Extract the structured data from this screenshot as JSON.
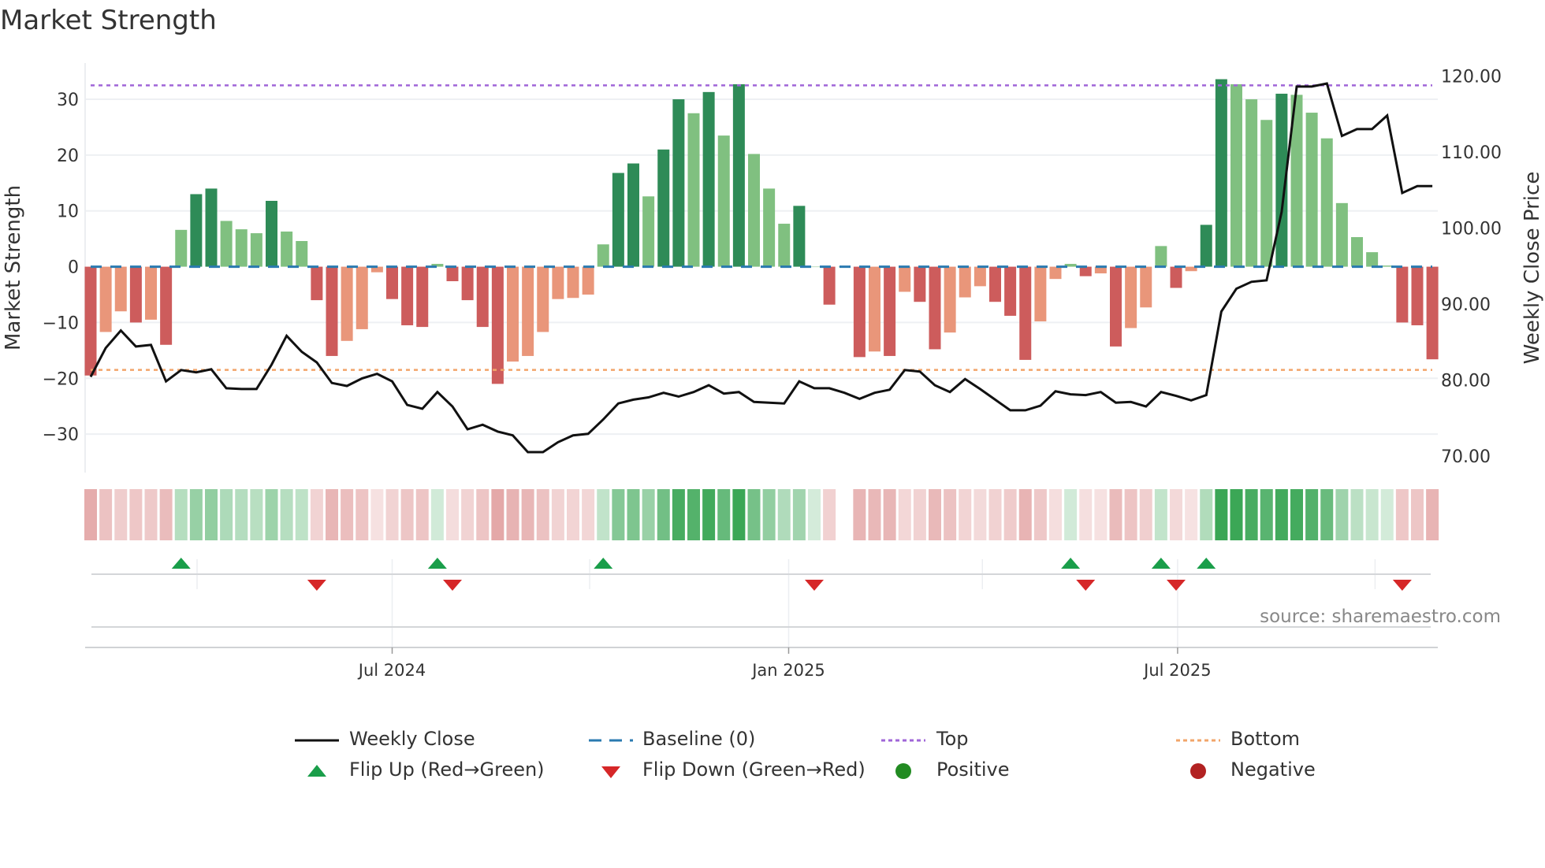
{
  "title": "Market Strength",
  "source": "source: sharemaestro.com",
  "legend": [
    {
      "label": "Weekly Close",
      "icon": "solid-line",
      "color": "#111111"
    },
    {
      "label": "Baseline (0)",
      "icon": "dashed-line",
      "color": "#2a7ab0"
    },
    {
      "label": "Top",
      "icon": "dotted-line",
      "color": "#a066d8"
    },
    {
      "label": "Bottom",
      "icon": "dotted-line",
      "color": "#f2a56a"
    },
    {
      "label": "Flip Up (Red→Green)",
      "icon": "triangle-up",
      "color": "#1a9e4a"
    },
    {
      "label": "Flip Down (Green→Red)",
      "icon": "triangle-down",
      "color": "#d62728"
    },
    {
      "label": "Positive",
      "icon": "circle",
      "color": "#228b22"
    },
    {
      "label": "Negative",
      "icon": "circle",
      "color": "#b22222"
    }
  ],
  "chart_data": {
    "type": "bar",
    "title": "Market Strength",
    "ylabel": "Market Strength",
    "y2label": "Weekly Close Price",
    "ylim": [
      -36.9,
      36.5
    ],
    "y2lim": [
      67.8,
      121.7
    ],
    "yticks": [
      "30",
      "20",
      "10",
      "0",
      "−10",
      "−20",
      "−30"
    ],
    "ytick_values": [
      30,
      20,
      10,
      0,
      -10,
      -20,
      -30
    ],
    "y2ticks": [
      "120.00",
      "110.00",
      "100.00",
      "90.00",
      "80.00",
      "70.00"
    ],
    "y2tick_values": [
      120,
      110,
      100,
      90,
      80,
      70
    ],
    "top_level": 32.5,
    "bottom_level": -18.5,
    "baseline": 0,
    "xticks": [
      {
        "label": "Jul 2024",
        "week": 20.0
      },
      {
        "label": "Jan 2025",
        "week": 46.3
      },
      {
        "label": "Jul 2025",
        "week": 72.1
      }
    ],
    "minor_grid_weeks": [
      7.06,
      33.1,
      59.15,
      85.2
    ],
    "strength": [
      -19.5,
      -11.7,
      -8,
      -10,
      -9.5,
      -14,
      6.6,
      13,
      14,
      8.2,
      6.7,
      6,
      11.8,
      6.3,
      4.6,
      -6,
      -16,
      -13.3,
      -11.2,
      -1,
      -5.8,
      -10.5,
      -10.8,
      0.5,
      -2.6,
      -6,
      -10.8,
      -21,
      -17,
      -16,
      -11.7,
      -5.8,
      -5.6,
      -5,
      4,
      16.8,
      18.5,
      12.6,
      21,
      30,
      27.5,
      31.3,
      23.5,
      32.7,
      20.2,
      14,
      7.7,
      10.9,
      0,
      -6.8,
      0,
      -16.2,
      -15.2,
      -16,
      -4.5,
      -6.3,
      -14.8,
      -11.8,
      -5.5,
      -3.5,
      -6.3,
      -8.8,
      -16.7,
      -9.8,
      -2.2,
      0.5,
      -1.7,
      -1.2,
      -14.3,
      -11,
      -7.3,
      3.7,
      -3.8,
      -0.8,
      7.5,
      33.6,
      32.7,
      30,
      26.3,
      31,
      30.8,
      27.6,
      23,
      11.4,
      5.3,
      2.6,
      0.2,
      -10,
      -10.5,
      -16.6
    ],
    "weekly_close": [
      80.4,
      84.2,
      86.5,
      84.4,
      84.6,
      79.8,
      81.3,
      81.0,
      81.4,
      78.9,
      78.8,
      78.8,
      82,
      85.8,
      83.7,
      82.3,
      79.6,
      79.2,
      80.2,
      80.8,
      79.8,
      76.7,
      76.2,
      78.4,
      76.5,
      73.5,
      74.1,
      73.2,
      72.7,
      70.5,
      70.5,
      71.8,
      72.7,
      72.9,
      74.8,
      76.9,
      77.4,
      77.7,
      78.3,
      77.8,
      78.4,
      79.3,
      78.2,
      78.4,
      77.1,
      77,
      76.9,
      79.8,
      78.9,
      78.9,
      78.3,
      77.5,
      78.3,
      78.7,
      81.3,
      81.1,
      79.3,
      78.4,
      80.1,
      78.8,
      77.4,
      76,
      76,
      76.6,
      78.5,
      78.1,
      78,
      78.4,
      77,
      77.1,
      76.5,
      78.4,
      77.9,
      77.3,
      78,
      89,
      92,
      92.9,
      93.1,
      102.1,
      118.6,
      118.6,
      119,
      112.1,
      113,
      113,
      114.8,
      104.6,
      105.5,
      105.5
    ],
    "flip_up_weeks": [
      6,
      23,
      34,
      65,
      71,
      74
    ],
    "flip_down_weeks": [
      15,
      24,
      48,
      66,
      72,
      87
    ],
    "strip_gap_weeks": [
      50
    ],
    "colors": {
      "pos_strong": "#2e8b57",
      "pos_weak": "#80c080",
      "neg_strong": "#cd5c5c",
      "neg_weak": "#e9967a",
      "baseline": "#2a7ab0",
      "top": "#a066d8",
      "bottom": "#f2a56a",
      "line": "#111111",
      "flip_up": "#1a9e4a",
      "flip_down": "#d62728"
    }
  }
}
